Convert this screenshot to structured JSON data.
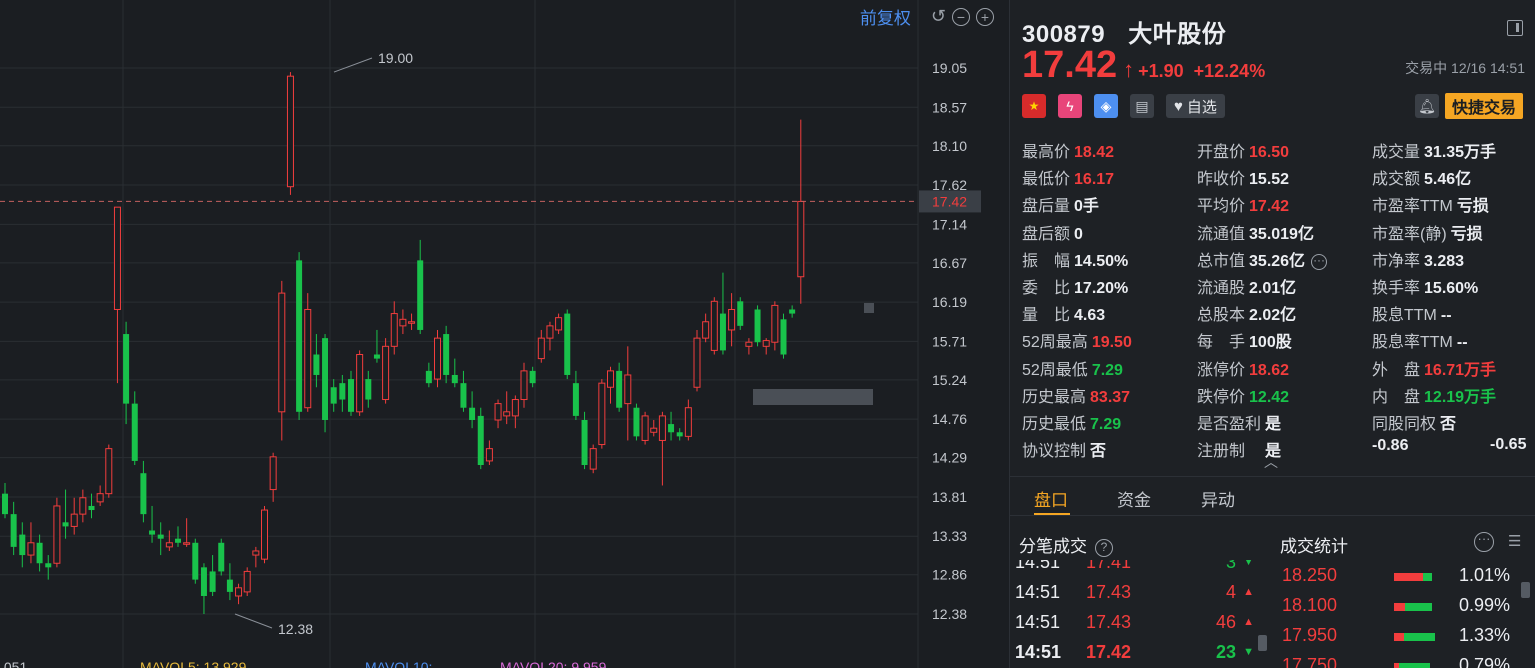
{
  "chart": {
    "adjust_label": "前复权",
    "y_ticks": [
      "19.05",
      "18.57",
      "18.10",
      "17.62",
      "17.14",
      "16.67",
      "16.19",
      "15.71",
      "15.24",
      "14.76",
      "14.29",
      "13.81",
      "13.33",
      "12.86",
      "12.38"
    ],
    "current_price_tag": "17.42",
    "high_annotation": "19.00",
    "low_annotation": "12.38",
    "mavol_labels": [
      ".051",
      "MAVOL5: 13.929",
      "MAVOL10:",
      "MAVOL20: 9.959"
    ],
    "up_color": "#f23d3d",
    "down_color": "#19c24b",
    "candles": [
      {
        "o": 13.85,
        "h": 13.98,
        "l": 13.55,
        "c": 13.6
      },
      {
        "o": 13.6,
        "h": 13.75,
        "l": 13.1,
        "c": 13.2
      },
      {
        "o": 13.35,
        "h": 13.5,
        "l": 12.95,
        "c": 13.1
      },
      {
        "o": 13.1,
        "h": 13.5,
        "l": 13.0,
        "c": 13.25
      },
      {
        "o": 13.25,
        "h": 13.35,
        "l": 12.9,
        "c": 13.0
      },
      {
        "o": 13.0,
        "h": 13.1,
        "l": 12.8,
        "c": 12.95
      },
      {
        "o": 13.0,
        "h": 13.8,
        "l": 12.95,
        "c": 13.7
      },
      {
        "o": 13.5,
        "h": 13.9,
        "l": 13.3,
        "c": 13.45
      },
      {
        "o": 13.45,
        "h": 13.8,
        "l": 13.35,
        "c": 13.6
      },
      {
        "o": 13.6,
        "h": 13.9,
        "l": 13.5,
        "c": 13.8
      },
      {
        "o": 13.7,
        "h": 13.85,
        "l": 13.55,
        "c": 13.65
      },
      {
        "o": 13.75,
        "h": 13.95,
        "l": 13.7,
        "c": 13.85
      },
      {
        "o": 13.85,
        "h": 14.45,
        "l": 13.8,
        "c": 14.4
      },
      {
        "o": 16.1,
        "h": 17.35,
        "l": 15.2,
        "c": 17.35
      },
      {
        "o": 15.8,
        "h": 15.95,
        "l": 14.7,
        "c": 14.95
      },
      {
        "o": 14.95,
        "h": 15.1,
        "l": 14.2,
        "c": 14.25
      },
      {
        "o": 14.1,
        "h": 14.25,
        "l": 13.5,
        "c": 13.6
      },
      {
        "o": 13.4,
        "h": 13.7,
        "l": 13.25,
        "c": 13.35
      },
      {
        "o": 13.35,
        "h": 13.5,
        "l": 13.1,
        "c": 13.3
      },
      {
        "o": 13.2,
        "h": 13.4,
        "l": 13.15,
        "c": 13.25
      },
      {
        "o": 13.3,
        "h": 13.45,
        "l": 13.2,
        "c": 13.25
      },
      {
        "o": 13.25,
        "h": 13.55,
        "l": 13.2,
        "c": 13.25
      },
      {
        "o": 13.25,
        "h": 13.3,
        "l": 12.75,
        "c": 12.8
      },
      {
        "o": 12.95,
        "h": 13.0,
        "l": 12.38,
        "c": 12.6
      },
      {
        "o": 12.9,
        "h": 13.1,
        "l": 12.6,
        "c": 12.65
      },
      {
        "o": 13.25,
        "h": 13.3,
        "l": 12.85,
        "c": 12.9
      },
      {
        "o": 12.8,
        "h": 13.0,
        "l": 12.55,
        "c": 12.65
      },
      {
        "o": 12.6,
        "h": 12.75,
        "l": 12.5,
        "c": 12.7
      },
      {
        "o": 12.65,
        "h": 12.95,
        "l": 12.6,
        "c": 12.9
      },
      {
        "o": 13.1,
        "h": 13.2,
        "l": 12.95,
        "c": 13.15
      },
      {
        "o": 13.05,
        "h": 13.7,
        "l": 13.0,
        "c": 13.65
      },
      {
        "o": 13.9,
        "h": 14.35,
        "l": 13.75,
        "c": 14.3
      },
      {
        "o": 14.85,
        "h": 16.45,
        "l": 14.5,
        "c": 16.3
      },
      {
        "o": 17.6,
        "h": 19.0,
        "l": 17.5,
        "c": 18.95
      },
      {
        "o": 16.7,
        "h": 16.8,
        "l": 14.75,
        "c": 14.85
      },
      {
        "o": 14.9,
        "h": 16.3,
        "l": 14.85,
        "c": 16.1
      },
      {
        "o": 15.55,
        "h": 15.8,
        "l": 15.15,
        "c": 15.3
      },
      {
        "o": 15.75,
        "h": 15.8,
        "l": 14.6,
        "c": 14.75
      },
      {
        "o": 15.15,
        "h": 15.25,
        "l": 14.85,
        "c": 14.95
      },
      {
        "o": 15.2,
        "h": 15.3,
        "l": 14.85,
        "c": 15.0
      },
      {
        "o": 15.25,
        "h": 15.35,
        "l": 14.8,
        "c": 14.85
      },
      {
        "o": 14.85,
        "h": 15.6,
        "l": 14.8,
        "c": 15.55
      },
      {
        "o": 15.25,
        "h": 15.35,
        "l": 14.9,
        "c": 15.0
      },
      {
        "o": 15.55,
        "h": 15.85,
        "l": 15.45,
        "c": 15.5
      },
      {
        "o": 15.0,
        "h": 15.75,
        "l": 14.95,
        "c": 15.65
      },
      {
        "o": 15.65,
        "h": 16.2,
        "l": 15.55,
        "c": 16.05
      },
      {
        "o": 15.9,
        "h": 16.1,
        "l": 15.8,
        "c": 15.98
      },
      {
        "o": 15.95,
        "h": 16.05,
        "l": 15.85,
        "c": 15.95
      },
      {
        "o": 16.7,
        "h": 16.95,
        "l": 15.8,
        "c": 15.85
      },
      {
        "o": 15.35,
        "h": 15.45,
        "l": 15.15,
        "c": 15.2
      },
      {
        "o": 15.25,
        "h": 15.85,
        "l": 15.15,
        "c": 15.75
      },
      {
        "o": 15.8,
        "h": 15.9,
        "l": 15.2,
        "c": 15.3
      },
      {
        "o": 15.3,
        "h": 15.5,
        "l": 15.15,
        "c": 15.2
      },
      {
        "o": 15.2,
        "h": 15.35,
        "l": 14.85,
        "c": 14.9
      },
      {
        "o": 14.9,
        "h": 15.1,
        "l": 14.65,
        "c": 14.75
      },
      {
        "o": 14.8,
        "h": 14.9,
        "l": 14.15,
        "c": 14.2
      },
      {
        "o": 14.25,
        "h": 14.5,
        "l": 14.2,
        "c": 14.4
      },
      {
        "o": 14.75,
        "h": 15.0,
        "l": 14.65,
        "c": 14.95
      },
      {
        "o": 14.8,
        "h": 15.1,
        "l": 14.7,
        "c": 14.85
      },
      {
        "o": 14.8,
        "h": 15.05,
        "l": 14.65,
        "c": 15.0
      },
      {
        "o": 15.0,
        "h": 15.45,
        "l": 14.9,
        "c": 15.35
      },
      {
        "o": 15.35,
        "h": 15.4,
        "l": 15.15,
        "c": 15.2
      },
      {
        "o": 15.5,
        "h": 15.85,
        "l": 15.45,
        "c": 15.75
      },
      {
        "o": 15.75,
        "h": 15.95,
        "l": 15.6,
        "c": 15.9
      },
      {
        "o": 15.85,
        "h": 16.05,
        "l": 15.8,
        "c": 16.0
      },
      {
        "o": 16.05,
        "h": 16.1,
        "l": 15.25,
        "c": 15.3
      },
      {
        "o": 15.2,
        "h": 15.35,
        "l": 14.75,
        "c": 14.8
      },
      {
        "o": 14.75,
        "h": 14.85,
        "l": 14.15,
        "c": 14.2
      },
      {
        "o": 14.15,
        "h": 14.45,
        "l": 14.1,
        "c": 14.4
      },
      {
        "o": 14.45,
        "h": 15.25,
        "l": 14.4,
        "c": 15.2
      },
      {
        "o": 15.15,
        "h": 15.4,
        "l": 14.95,
        "c": 15.35
      },
      {
        "o": 15.35,
        "h": 15.45,
        "l": 14.85,
        "c": 14.9
      },
      {
        "o": 14.95,
        "h": 15.65,
        "l": 14.5,
        "c": 15.3
      },
      {
        "o": 14.9,
        "h": 14.95,
        "l": 14.5,
        "c": 14.55
      },
      {
        "o": 14.5,
        "h": 14.85,
        "l": 14.45,
        "c": 14.8
      },
      {
        "o": 14.6,
        "h": 14.75,
        "l": 14.55,
        "c": 14.65
      },
      {
        "o": 14.5,
        "h": 14.85,
        "l": 13.95,
        "c": 14.8
      },
      {
        "o": 14.7,
        "h": 14.85,
        "l": 14.5,
        "c": 14.6
      },
      {
        "o": 14.6,
        "h": 14.65,
        "l": 14.5,
        "c": 14.55
      },
      {
        "o": 14.55,
        "h": 15.0,
        "l": 14.5,
        "c": 14.9
      },
      {
        "o": 15.15,
        "h": 15.85,
        "l": 15.1,
        "c": 15.75
      },
      {
        "o": 15.75,
        "h": 16.05,
        "l": 15.7,
        "c": 15.95
      },
      {
        "o": 15.6,
        "h": 16.25,
        "l": 15.55,
        "c": 16.2
      },
      {
        "o": 16.05,
        "h": 16.55,
        "l": 15.55,
        "c": 15.6
      },
      {
        "o": 15.85,
        "h": 16.3,
        "l": 15.65,
        "c": 16.1
      },
      {
        "o": 16.2,
        "h": 16.25,
        "l": 15.85,
        "c": 15.9
      },
      {
        "o": 15.65,
        "h": 15.75,
        "l": 15.55,
        "c": 15.7
      },
      {
        "o": 16.1,
        "h": 16.15,
        "l": 15.65,
        "c": 15.7
      },
      {
        "o": 15.65,
        "h": 15.75,
        "l": 15.55,
        "c": 15.72
      },
      {
        "o": 15.7,
        "h": 16.2,
        "l": 15.6,
        "c": 16.15
      },
      {
        "o": 15.98,
        "h": 16.05,
        "l": 15.5,
        "c": 15.55
      },
      {
        "o": 16.1,
        "h": 16.15,
        "l": 16.0,
        "c": 16.05
      },
      {
        "o": 16.5,
        "h": 18.42,
        "l": 16.17,
        "c": 17.42
      }
    ]
  },
  "quote": {
    "code": "300879",
    "name": "大叶股份",
    "price": "17.42",
    "change": "+1.90",
    "change_pct": "+12.24%",
    "status": "交易中 12/16 14:51",
    "watch_label": "自选",
    "fast_trade_label": "快捷交易",
    "stats": [
      {
        "label": "最高价",
        "value": "18.42",
        "color": "up"
      },
      {
        "label": "最低价",
        "value": "16.17",
        "color": "up"
      },
      {
        "label": "盘后量",
        "value": "0手",
        "color": "wt"
      },
      {
        "label": "盘后额",
        "value": "0",
        "color": "wt"
      },
      {
        "label": "振　幅",
        "value": "14.50%",
        "color": "wt"
      },
      {
        "label": "委　比",
        "value": "17.20%",
        "color": "wt"
      },
      {
        "label": "量　比",
        "value": "4.63",
        "color": "wt"
      },
      {
        "label": "52周最高",
        "value": "19.50",
        "color": "up"
      },
      {
        "label": "52周最低",
        "value": "7.29",
        "color": "dn"
      },
      {
        "label": "历史最高",
        "value": "83.37",
        "color": "up"
      },
      {
        "label": "历史最低",
        "value": "7.29",
        "color": "dn"
      },
      {
        "label": "协议控制",
        "value": "否",
        "color": "wt"
      },
      {
        "label": "开盘价",
        "value": "16.50",
        "color": "up"
      },
      {
        "label": "昨收价",
        "value": "15.52",
        "color": "wt"
      },
      {
        "label": "平均价",
        "value": "17.42",
        "color": "up"
      },
      {
        "label": "流通值",
        "value": "35.019亿",
        "color": "wt"
      },
      {
        "label": "总市值",
        "value": "35.26亿",
        "color": "wt"
      },
      {
        "label": "流通股",
        "value": "2.01亿",
        "color": "wt"
      },
      {
        "label": "总股本",
        "value": "2.02亿",
        "color": "wt"
      },
      {
        "label": "每　手",
        "value": "100股",
        "color": "wt"
      },
      {
        "label": "涨停价",
        "value": "18.62",
        "color": "up"
      },
      {
        "label": "跌停价",
        "value": "12.42",
        "color": "dn"
      },
      {
        "label": "是否盈利",
        "value": "是",
        "color": "wt"
      },
      {
        "label": "注册制",
        "value": "　是",
        "color": "wt"
      },
      {
        "label": "成交量",
        "value": "31.35万手",
        "color": "wt"
      },
      {
        "label": "成交额",
        "value": "5.46亿",
        "color": "wt"
      },
      {
        "label": "市盈率TTM",
        "value": "亏损",
        "color": "wt"
      },
      {
        "label": "市盈率(静)",
        "value": "亏损",
        "color": "wt"
      },
      {
        "label": "市净率",
        "value": "3.283",
        "color": "wt"
      },
      {
        "label": "换手率",
        "value": "15.60%",
        "color": "wt"
      },
      {
        "label": "股息TTM",
        "value": "--",
        "color": "wt"
      },
      {
        "label": "股息率TTM",
        "value": "--",
        "color": "wt"
      },
      {
        "label": "外　盘",
        "value": "16.71万手",
        "color": "up"
      },
      {
        "label": "内　盘",
        "value": "12.19万手",
        "color": "dn"
      },
      {
        "label": "同股同权",
        "value": "否",
        "color": "wt"
      },
      {
        "label": "-0.86",
        "value": "",
        "color": "wt"
      }
    ],
    "extra_right": "-0.65",
    "tabs": [
      "盘口",
      "资金",
      "异动"
    ],
    "trade_title": "分笔成交",
    "stat_title": "成交统计",
    "trades": [
      {
        "time": "14:51",
        "price": "17.41",
        "vol": "3",
        "dir": "dn"
      },
      {
        "time": "14:51",
        "price": "17.43",
        "vol": "4",
        "dir": "up"
      },
      {
        "time": "14:51",
        "price": "17.43",
        "vol": "46",
        "dir": "up"
      },
      {
        "time": "14:51",
        "price": "17.42",
        "vol": "23",
        "dir": "dn"
      }
    ],
    "trade_stats": [
      {
        "price": "18.250",
        "pct": "1.01%",
        "red": 0.75
      },
      {
        "price": "18.100",
        "pct": "0.99%",
        "red": 0.3
      },
      {
        "price": "17.950",
        "pct": "1.33%",
        "red": 0.25
      },
      {
        "price": "17.750",
        "pct": "0.79%",
        "red": 0.15
      }
    ]
  }
}
